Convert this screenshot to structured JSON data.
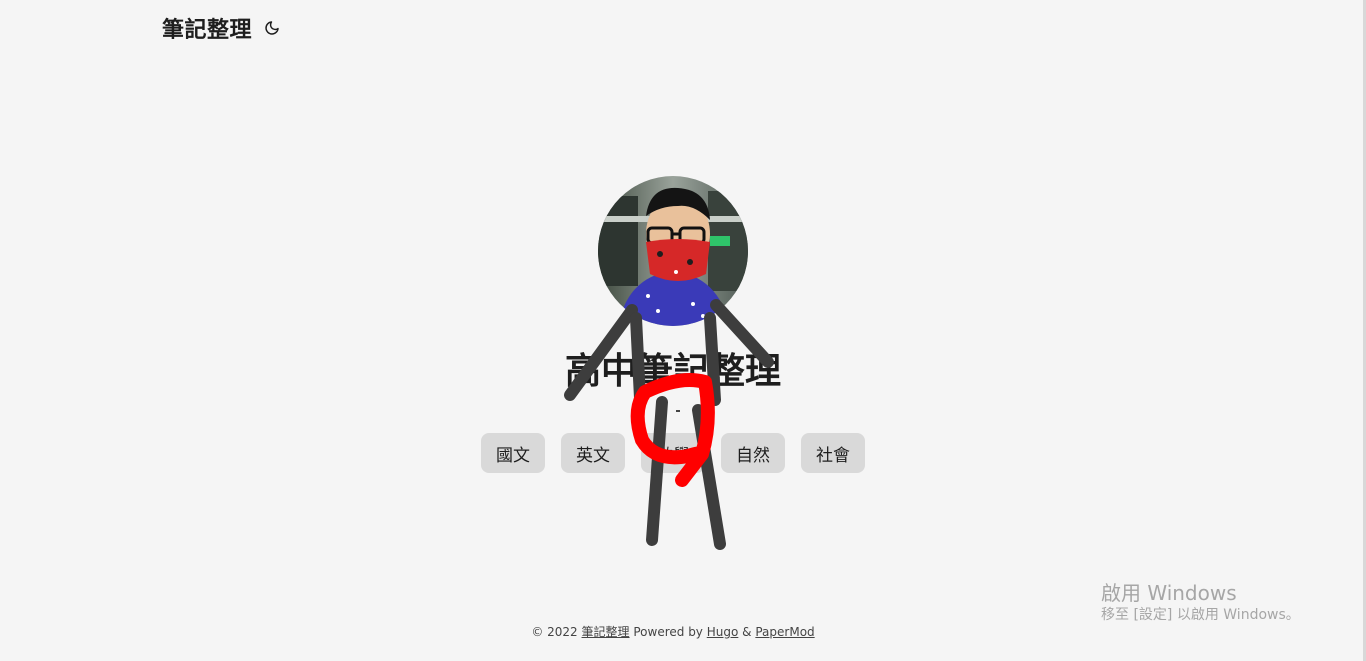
{
  "header": {
    "logo_text": "筆記整理",
    "theme_icon": "moon-icon"
  },
  "profile": {
    "title": "高中筆記整理",
    "avatar_alt": "avatar"
  },
  "buttons": [
    {
      "label": "國文"
    },
    {
      "label": "英文"
    },
    {
      "label": "數學"
    },
    {
      "label": "自然"
    },
    {
      "label": "社會"
    }
  ],
  "footer": {
    "copyright": "© 2022",
    "site_link": "筆記整理",
    "powered_by": "Powered by",
    "hugo_link": "Hugo",
    "amp": "&",
    "theme_link": "PaperMod"
  },
  "watermark": {
    "title": "啟用 Windows",
    "subtitle": "移至 [設定] 以啟用 Windows。"
  },
  "colors": {
    "background": "#f5f5f5",
    "button_bg": "#d9d9d9",
    "text": "#1e1e1e",
    "doodle_gray": "#3d3d3d",
    "doodle_red": "#ff0000"
  }
}
